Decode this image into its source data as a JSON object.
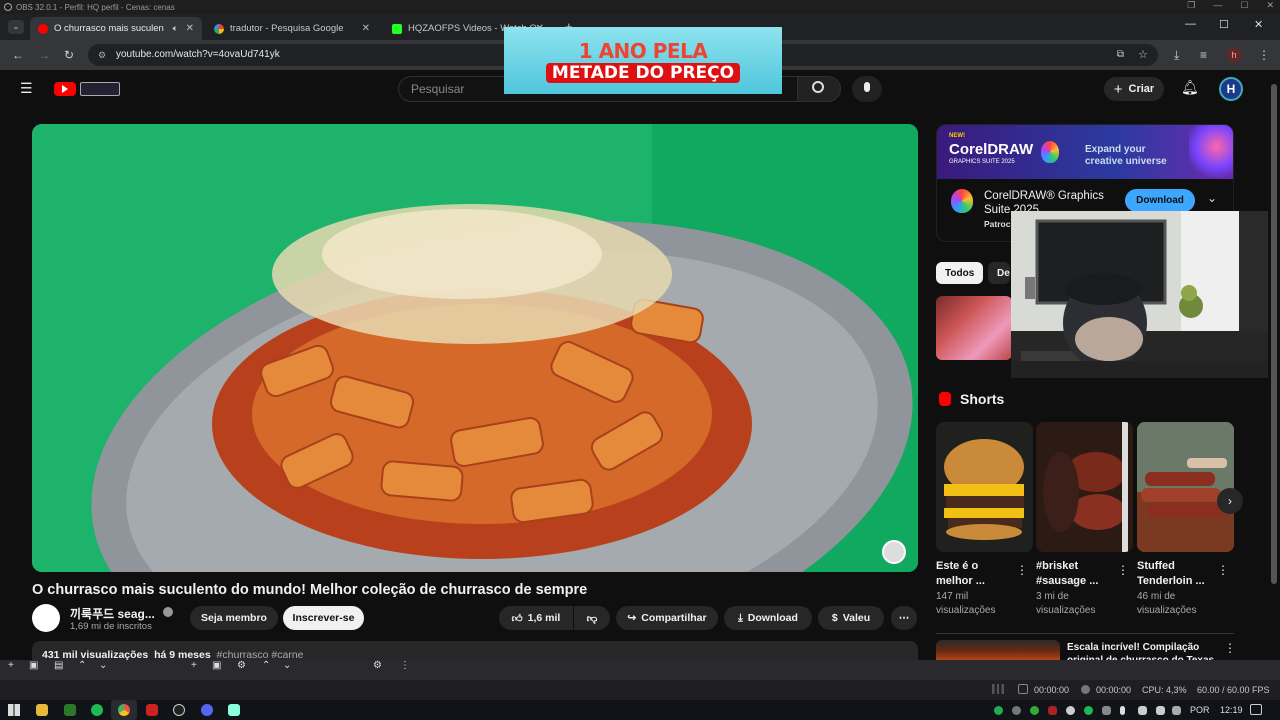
{
  "obs": {
    "title": "OBS 32.0.1 - Perfil: HQ perfil - Cenas: cenas",
    "status": {
      "time1": "00:00:00",
      "time2": "00:00:00",
      "cpu": "CPU: 4,3%",
      "fps": "60.00 / 60.00 FPS"
    }
  },
  "browser": {
    "tabs": [
      {
        "label": "O churrasco mais suculento do mundo",
        "active": true
      },
      {
        "label": "tradutor - Pesquisa Google",
        "active": false
      },
      {
        "label": "HQZAOFPS Videos - Watch On Twitch",
        "active": false
      }
    ],
    "url": "youtube.com/watch?v=4ovaUd741yk",
    "avatar_letter": "h"
  },
  "youtube": {
    "search_placeholder": "Pesquisar",
    "create_label": "Criar",
    "avatar_letter": "H",
    "video": {
      "title": "O churrasco mais suculento do mundo! Melhor coleção de churrasco de sempre",
      "channel": "끼룩푸드 seag...",
      "subscribers": "1,69 mi de inscritos",
      "member_label": "Seja membro",
      "subscribe_label": "Inscrever-se",
      "likes": "1,6 mil",
      "share_label": "Compartilhar",
      "download_label": "Download",
      "thanks_label": "Valeu",
      "views": "431 mil visualizações",
      "age": "há 9 meses",
      "tags": "#churrasco #carne"
    },
    "ad": {
      "banner_new": "NEW!",
      "banner_brand": "CorelDRAW",
      "banner_sub": "GRAPHICS SUITE 2025",
      "banner_tagline": "Expand your creative universe",
      "title": "CorelDRAW® Graphics Suite 2025",
      "sponsor": "Patroc",
      "button_label": "Download"
    },
    "chips": [
      "Todos",
      "De"
    ],
    "shorts_heading": "Shorts",
    "shorts": [
      {
        "title": "Este é o melhor ...",
        "views": "147 mil",
        "views_unit": "visualizações"
      },
      {
        "title": "#brisket #sausage ...",
        "views": "3 mi de",
        "views_unit": "visualizações"
      },
      {
        "title": "Stuffed Tenderloin ...",
        "views": "46 mi de",
        "views_unit": "visualizações"
      }
    ],
    "next_video": {
      "title": "Escala incrível! Compilação original de churrasco do Texas"
    }
  },
  "promo": {
    "line1": "1 ANO PELA",
    "line2": "METADE DO PREÇO"
  },
  "taskbar": {
    "lang": "POR",
    "time": "12:19"
  }
}
